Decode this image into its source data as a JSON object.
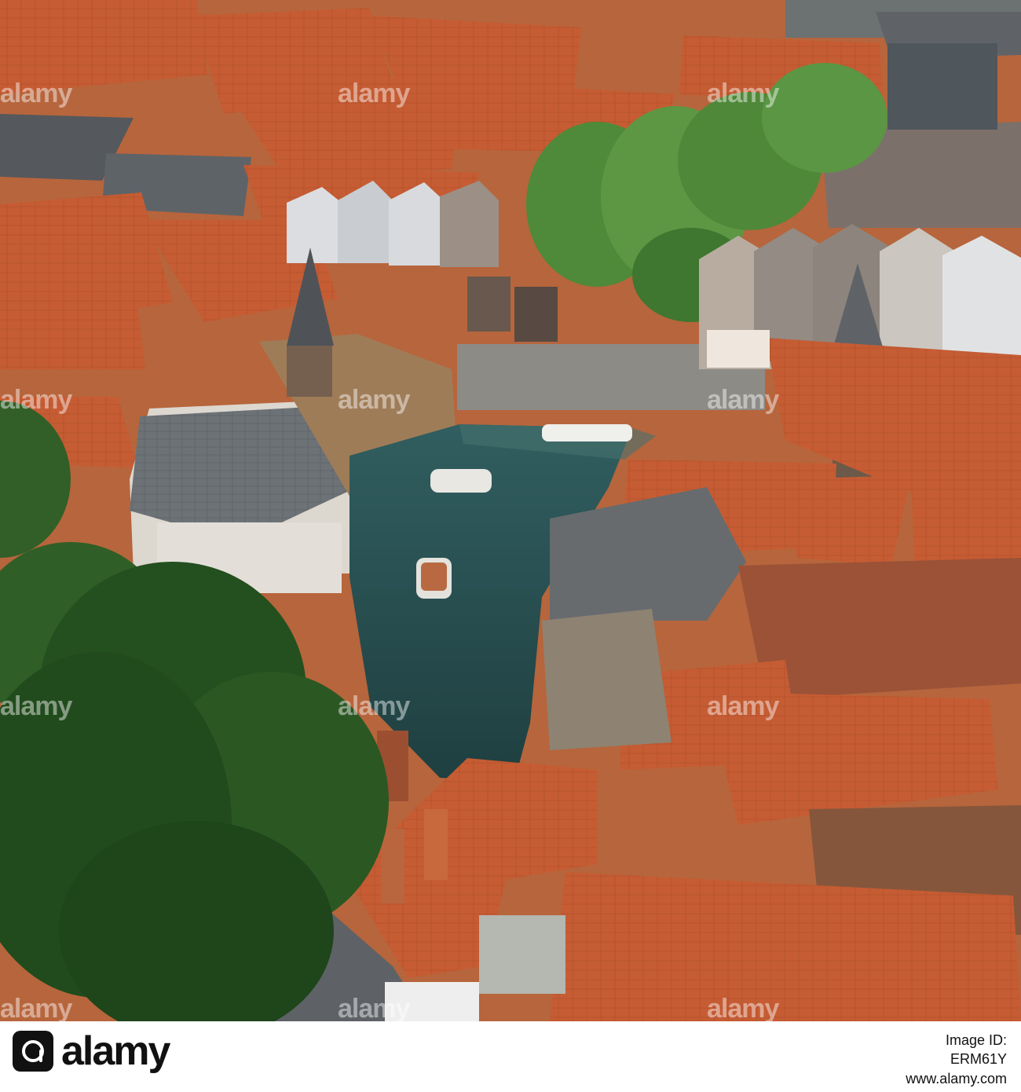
{
  "watermark": {
    "text": "alamy"
  },
  "footer": {
    "logo_text": "alamy",
    "image_id_label": "Image ID:",
    "image_id": "ERM61Y",
    "url": "www.alamy.com"
  },
  "colors": {
    "roof": "#c65c33",
    "roof_dark": "#8d3f1f",
    "slate": "#6f7479",
    "facade": "#ddd8cf",
    "water": "#2c5254",
    "tree": "#1e4b1d",
    "street": "#8c8b86"
  }
}
